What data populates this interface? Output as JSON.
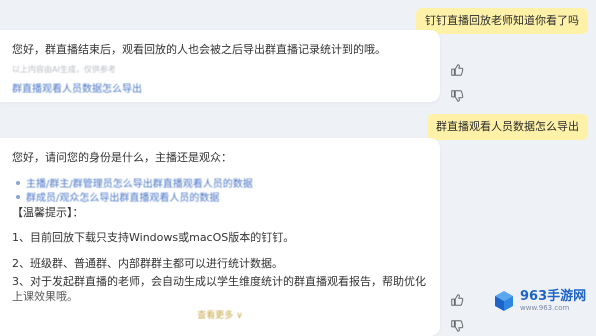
{
  "messages": {
    "user_1": "钉钉直播回放老师知道你看了吗",
    "bot_1": {
      "text": "您好，群直播结束后，观看回放的人也会被之后导出群直播记录统计到的哦。",
      "note": "以上内容由AI生成，仅供参考",
      "related_link": "群直播观看人员数据怎么导出"
    },
    "user_2": "群直播观看人员数据怎么导出",
    "bot_2": {
      "intro": "您好，请问您的身份是什么，主播还是观众：",
      "options": [
        "主播/群主/群管理员怎么导出群直播观看人员的数据",
        "群成员/观众怎么导出群直播观看人员的数据"
      ],
      "tip_title": "【温馨提示】：",
      "points": [
        "1、目前回放下载只支持Windows或macOS版本的钉钉。",
        "2、班级群、普通群、内部群群主都可以进行统计数据。",
        "3、对于发起群直播的老师，会自动生成以学生维度统计的群直播观看报告，帮助优化上课效果哦。"
      ],
      "expand_label": "查看更多 ∨"
    }
  },
  "watermark": {
    "name": "963手游网",
    "url": "www.963.com"
  },
  "colors": {
    "user_bubble": "#fff2a8",
    "link": "#4a76c6",
    "brand": "#1e64c8"
  },
  "icons": [
    "thumbs-up-icon",
    "thumbs-down-icon",
    "cube-logo-icon"
  ]
}
